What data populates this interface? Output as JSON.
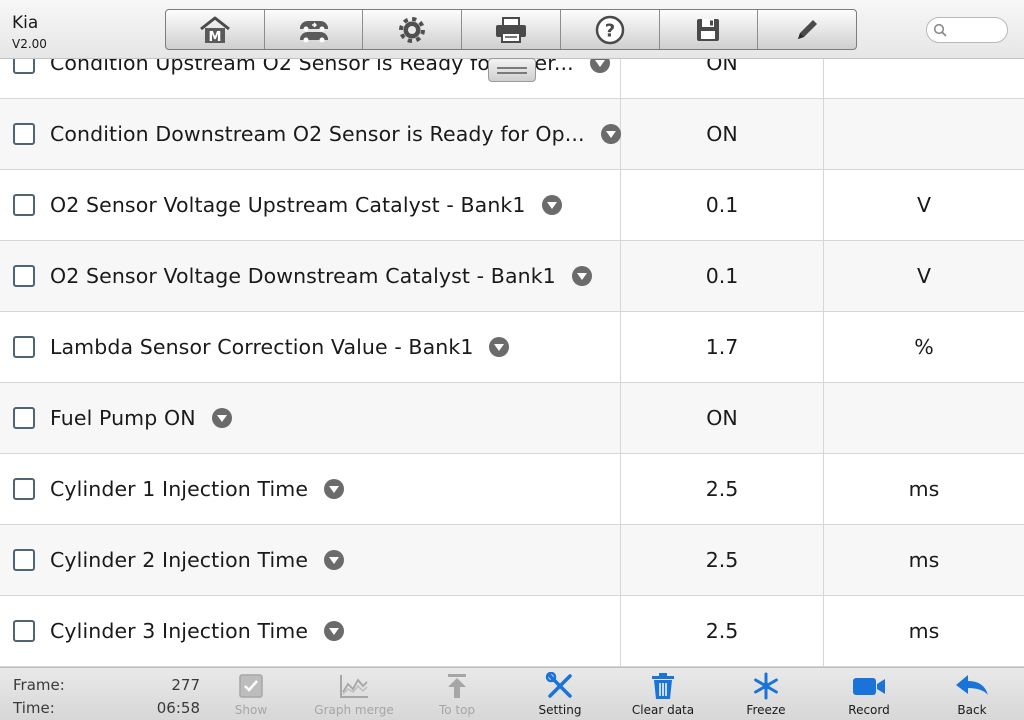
{
  "header": {
    "app_name": "Kia",
    "version": "V2.00",
    "toolbar": [
      {
        "name": "home-button",
        "icon": "home-m-icon"
      },
      {
        "name": "vehicle-swap-button",
        "icon": "car-swap-icon"
      },
      {
        "name": "settings-button",
        "icon": "gear-icon"
      },
      {
        "name": "print-button",
        "icon": "printer-icon"
      },
      {
        "name": "help-button",
        "icon": "help-icon"
      },
      {
        "name": "save-button",
        "icon": "floppy-disk-icon"
      },
      {
        "name": "edit-button",
        "icon": "pencil-icon"
      }
    ],
    "search": {
      "value": "",
      "placeholder": "",
      "icon": "search-icon"
    }
  },
  "table": {
    "rows": [
      {
        "name": "Condition Upstream O2 Sensor is Ready for Oper...",
        "value": "ON",
        "unit": ""
      },
      {
        "name": "Condition Downstream O2 Sensor is Ready for Op...",
        "value": "ON",
        "unit": ""
      },
      {
        "name": "O2 Sensor Voltage Upstream Catalyst - Bank1",
        "value": "0.1",
        "unit": "V"
      },
      {
        "name": "O2 Sensor Voltage Downstream Catalyst - Bank1",
        "value": "0.1",
        "unit": "V"
      },
      {
        "name": "Lambda Sensor Correction Value - Bank1",
        "value": "1.7",
        "unit": "%"
      },
      {
        "name": "Fuel Pump ON",
        "value": "ON",
        "unit": ""
      },
      {
        "name": "Cylinder 1 Injection Time",
        "value": "2.5",
        "unit": "ms"
      },
      {
        "name": "Cylinder 2 Injection Time",
        "value": "2.5",
        "unit": "ms"
      },
      {
        "name": "Cylinder 3 Injection Time",
        "value": "2.5",
        "unit": "ms"
      }
    ]
  },
  "footer": {
    "frame_label": "Frame:",
    "frame_value": "277",
    "time_label": "Time:",
    "time_value": "06:58",
    "buttons": {
      "show": {
        "label": "Show",
        "icon": "checkbox-icon",
        "enabled": false
      },
      "graph_merge": {
        "label": "Graph merge",
        "icon": "graph-icon",
        "enabled": false
      },
      "to_top": {
        "label": "To top",
        "icon": "arrow-up-icon",
        "enabled": false
      },
      "setting": {
        "label": "Setting",
        "icon": "wrench-screwdriver-icon",
        "enabled": true
      },
      "clear_data": {
        "label": "Clear data",
        "icon": "trash-icon",
        "enabled": true
      },
      "freeze": {
        "label": "Freeze",
        "icon": "snowflake-icon",
        "enabled": true
      },
      "record": {
        "label": "Record",
        "icon": "video-camera-icon",
        "enabled": true
      },
      "back": {
        "label": "Back",
        "icon": "back-arrow-icon",
        "enabled": true
      }
    }
  },
  "colors": {
    "accent_blue": "#1a73d8",
    "disabled_gray": "#a6a6a6",
    "icon_dark": "#4a4a4a"
  }
}
